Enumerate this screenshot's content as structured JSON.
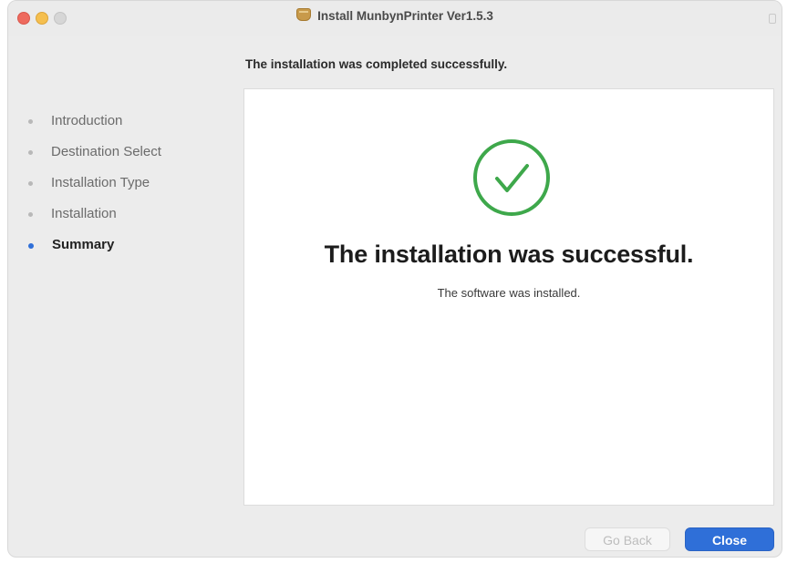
{
  "window": {
    "title": "Install MunbynPrinter Ver1.5.3"
  },
  "heading": "The installation was completed successfully.",
  "steps": [
    {
      "label": "Introduction",
      "active": false
    },
    {
      "label": "Destination Select",
      "active": false
    },
    {
      "label": "Installation Type",
      "active": false
    },
    {
      "label": "Installation",
      "active": false
    },
    {
      "label": "Summary",
      "active": true
    }
  ],
  "result": {
    "title": "The installation was successful.",
    "subtitle": "The software was installed.",
    "icon": "checkmark-circle-icon",
    "icon_color": "#3ea84b"
  },
  "buttons": {
    "back_label": "Go Back",
    "close_label": "Close"
  },
  "colors": {
    "accent": "#2f6fd8",
    "success": "#3ea84b"
  }
}
